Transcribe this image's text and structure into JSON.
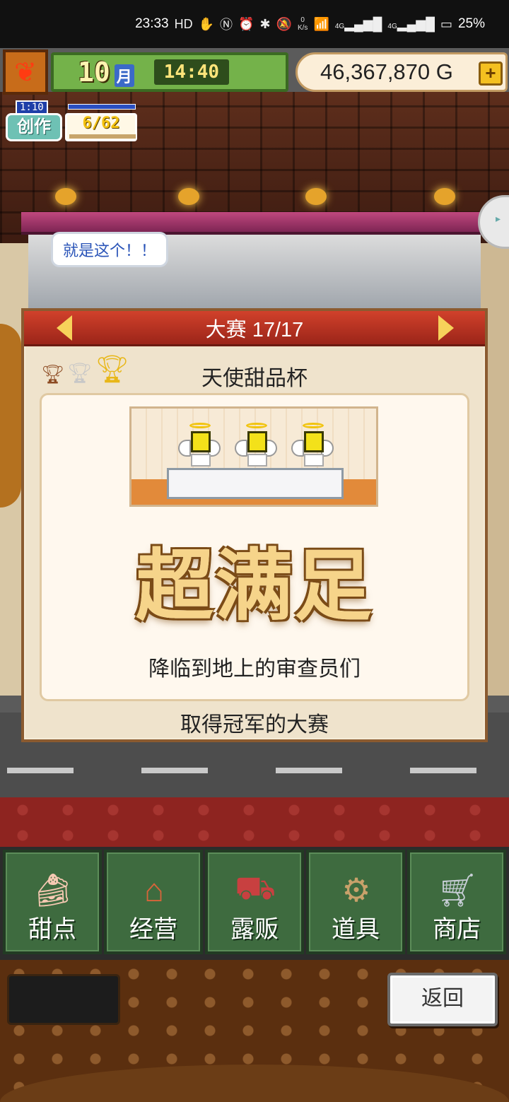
{
  "status_bar": {
    "time": "23:33",
    "hd_label": "HD",
    "net_speed_value": "0",
    "net_speed_unit": "K/s",
    "net_label_1": "4G",
    "net_label_2": "4G",
    "battery": "25%"
  },
  "hud": {
    "month_number": "10",
    "month_label": "月",
    "clock": "14:40",
    "money": "46,367,870 G",
    "add_money_icon": "plus-icon",
    "season_icon": "maple-leaf-icon"
  },
  "craft": {
    "timer": "1:10",
    "label": "创作",
    "count": "6/62"
  },
  "speech_bubble": "就是这个！！",
  "contest": {
    "header_title": "大赛 17/17",
    "name": "天使甜品杯",
    "rating": "超满足",
    "description": "降临到地上的审查员们",
    "footer": "取得冠军的大赛",
    "trophy_icons": [
      "bronze-trophy-icon",
      "silver-trophy-icon",
      "gold-trophy-icon"
    ]
  },
  "menu": {
    "items": [
      {
        "label": "甜点",
        "icon": "cake-icon"
      },
      {
        "label": "经营",
        "icon": "shop-building-icon"
      },
      {
        "label": "露贩",
        "icon": "food-truck-icon"
      },
      {
        "label": "道具",
        "icon": "gear-bag-icon"
      },
      {
        "label": "商店",
        "icon": "shopping-cart-icon"
      }
    ]
  },
  "back_button": "返回",
  "colors": {
    "header_red": "#c2372a",
    "menu_green": "#3e6b3f",
    "rating_gold": "#f6d48a",
    "hud_green": "#74b24a"
  }
}
